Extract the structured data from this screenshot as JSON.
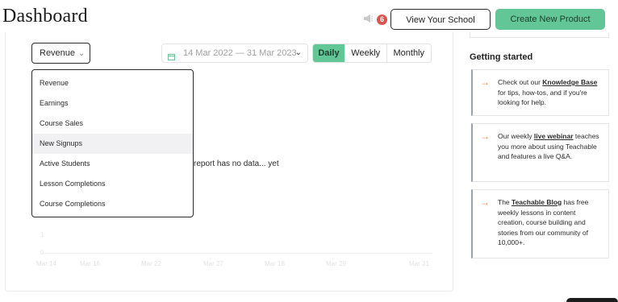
{
  "header": {
    "title": "Dashboard",
    "notification_count": "6",
    "view_school_label": "View Your School",
    "create_product_label": "Create New Product"
  },
  "filters": {
    "metric_selected": "Revenue",
    "date_start": "14 Mar 2022",
    "date_sep": "—",
    "date_end": "31 Mar 2023",
    "periods": [
      {
        "label": "Daily",
        "active": true
      },
      {
        "label": "Weekly",
        "active": false
      },
      {
        "label": "Monthly",
        "active": false
      }
    ]
  },
  "dropdown": {
    "options": [
      "Revenue",
      "Earnings",
      "Course Sales",
      "New Signups",
      "Active Students",
      "Lesson Completions",
      "Course Completions"
    ],
    "hovered": "New Signups"
  },
  "chart": {
    "empty_message": "report has no data... yet",
    "y_ticks": [
      "1",
      "0"
    ],
    "x_ticks": [
      "Mar 14",
      "Mar 16",
      "Mar 22",
      "Mar 27",
      "Mar 18",
      "Mar 29",
      "Mar 31"
    ]
  },
  "getting_started": {
    "title": "Getting started",
    "cards": [
      {
        "pre": "Check out our ",
        "link": "Knowledge Base",
        "post": " for tips, how-tos, and if you're looking for help."
      },
      {
        "pre": "Our weekly ",
        "link": "live webinar",
        "post": " teaches you more about using Teachable and features a live Q&A."
      },
      {
        "pre": "The ",
        "link": "Teachable Blog",
        "post": " has free weekly lessons in content creation, course building and stories from our community of 10,000+."
      }
    ]
  },
  "colors": {
    "accent_green": "#63c697",
    "badge_red": "#d9534f",
    "arrow_orange": "#f0874a"
  }
}
